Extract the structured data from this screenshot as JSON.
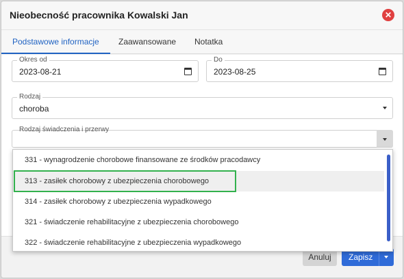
{
  "dialog": {
    "title": "Nieobecność pracownika Kowalski Jan",
    "close_icon": "close-icon"
  },
  "tabs": [
    {
      "label": "Podstawowe informacje",
      "active": true
    },
    {
      "label": "Zaawansowane",
      "active": false
    },
    {
      "label": "Notatka",
      "active": false
    }
  ],
  "form": {
    "okres_od": {
      "label": "Okres od",
      "value": "2023-08-21"
    },
    "do": {
      "label": "Do",
      "value": "2023-08-25"
    },
    "rodzaj": {
      "label": "Rodzaj",
      "value": "choroba"
    },
    "rodzaj_swiadczenia": {
      "label": "Rodzaj świadczenia i przerwy",
      "value": ""
    }
  },
  "dropdown": {
    "options": [
      "331 - wynagrodzenie chorobowe finansowane ze środków pracodawcy",
      "313 - zasiłek chorobowy z ubezpieczenia chorobowego",
      "314 - zasiłek chorobowy z ubezpieczenia wypadkowego",
      "321 - świadczenie rehabilitacyjne z ubezpieczenia chorobowego",
      "322 - świadczenie rehabilitacyjne z ubezpieczenia wypadkowego"
    ],
    "hovered_index": 1
  },
  "footer": {
    "cancel_label": "Anuluj",
    "save_label": "Zapisz"
  },
  "colors": {
    "accent": "#1f62c2",
    "save_button": "#2f6bd8",
    "close_button": "#e04040",
    "highlight": "#32b14d"
  }
}
